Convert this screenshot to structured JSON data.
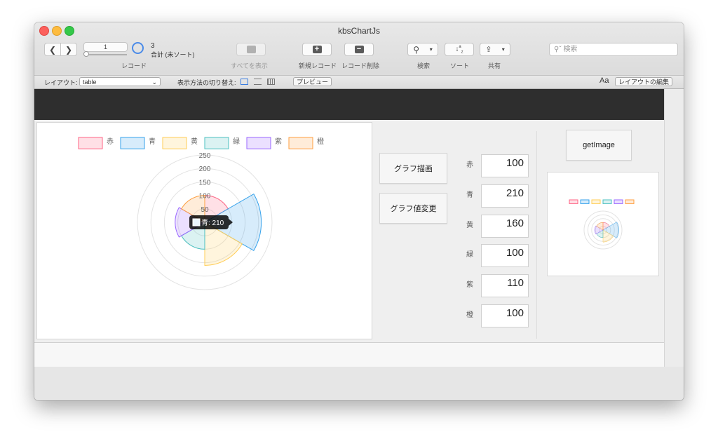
{
  "window": {
    "title": "kbsChartJs"
  },
  "toolbar": {
    "record_number": "1",
    "record_count": "3",
    "record_status": "合計 (未ソート)",
    "record_label": "レコード",
    "show_all_label": "すべてを表示",
    "new_record_label": "新規レコード",
    "delete_record_label": "レコード削除",
    "search_label": "検索",
    "sort_label": "ソート",
    "share_label": "共有",
    "search_placeholder": "検索"
  },
  "layoutbar": {
    "layout_label": "レイアウト:",
    "layout_value": "table",
    "view_switch_label": "表示方法の切り替え:",
    "preview_label": "プレビュー",
    "font_icon_text": "Aa",
    "edit_layout_label": "レイアウトの編集"
  },
  "buttons": {
    "draw_graph": "グラフ描画",
    "change_values": "グラフ値変更",
    "get_image": "getImage"
  },
  "fields": [
    {
      "label": "赤",
      "value": "100"
    },
    {
      "label": "青",
      "value": "210"
    },
    {
      "label": "黄",
      "value": "160"
    },
    {
      "label": "緑",
      "value": "100"
    },
    {
      "label": "紫",
      "value": "110"
    },
    {
      "label": "橙",
      "value": "100"
    }
  ],
  "tooltip": {
    "text": "青: 210"
  },
  "chart_data": {
    "type": "polarArea",
    "categories": [
      "赤",
      "青",
      "黄",
      "緑",
      "紫",
      "橙"
    ],
    "values": [
      100,
      210,
      160,
      100,
      110,
      100
    ],
    "colors": [
      "#ff6384",
      "#36a2eb",
      "#ffcd56",
      "#4bc0c0",
      "#9966ff",
      "#ff9f40"
    ],
    "rlim": [
      0,
      250
    ],
    "ticks": [
      "50",
      "100",
      "150",
      "200",
      "250"
    ],
    "legend_position": "top",
    "title": ""
  }
}
